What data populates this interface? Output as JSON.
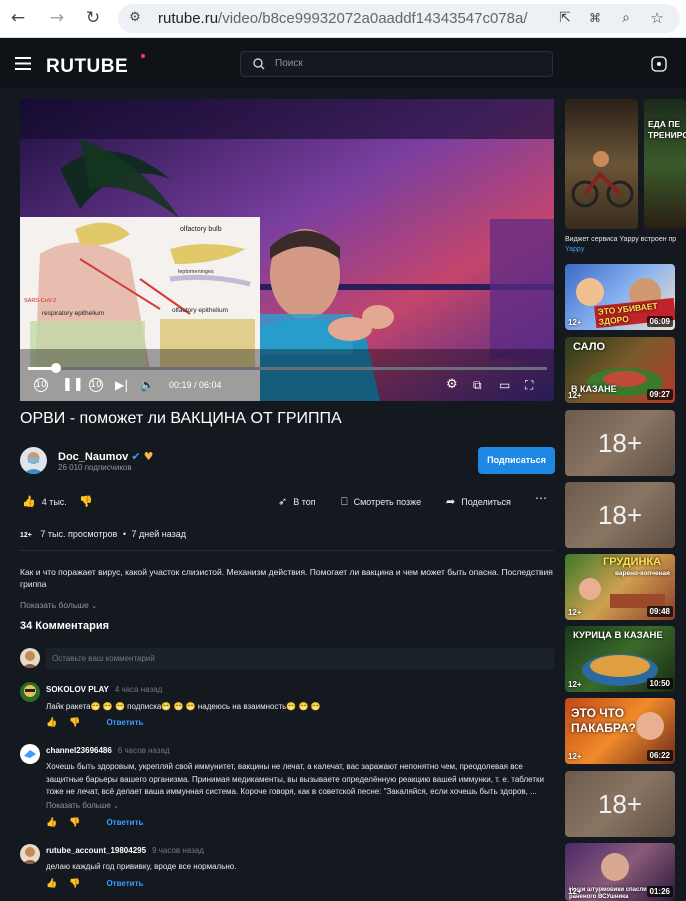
{
  "browser": {
    "back_icon": "back-arrow-icon",
    "url_domain": "rutube.ru",
    "url_path": "/video/b8ce99932072a0aaddf14343547c078a/"
  },
  "header": {
    "logo": "RUTUBE",
    "search_placeholder": "Поиск"
  },
  "player": {
    "time": "00:19 / 06:04",
    "overlay_label_1": "olfactory bulb",
    "overlay_label_2": "leptomeninges",
    "overlay_label_3": "respiratory epithelium",
    "overlay_label_4": "olfactory epithelium",
    "overlay_label_5": "SARS-CoV-2",
    "progress_fraction": 0.053,
    "rewind_label": "10",
    "forward_label": "10"
  },
  "video": {
    "title": "ОРВИ - поможет ли ВАКЦИНА ОТ ГРИППА",
    "channel": "Doc_Naumov",
    "subscribers": "26 010 подписчиков",
    "subscribe_label": "Подписаться",
    "likes": "4 тыс.",
    "to_top": "В топ",
    "watch_later": "Смотреть позже",
    "share": "Поделиться",
    "age_badge": "12+",
    "views": "7 тыс. просмотров",
    "dot": "•",
    "posted": "7 дней назад",
    "description": "Как и что поражает вирус, какой участок слизистой. Механизм действия. Помогает ли вакцина и чем может быть опасна. Последствия гриппа",
    "show_more": "Показать больше"
  },
  "comments": {
    "count_label": "34 Комментария",
    "input_placeholder": "Оставьте ваш комментарий",
    "reply_label": "Ответить",
    "items": [
      {
        "author": "SOKOLOV PLAY",
        "ago": "4 часа назад",
        "text": "Лайк ракета😁 😁 😁 подписка😁 😁 😁 надеюсь на взаимность😁 😁 😁"
      },
      {
        "author": "channel23696486",
        "ago": "6 часов назад",
        "text": "Хочешь быть здоровым, укрепляй свой иммунитет,  вакцины не лечат, а калечат, вас заражают непонятно чем, преодолевая все защитные барьеры вашего организма. Принимая медикаменты, вы вызываете определённую реакцию вашей иммунки, т. е. таблетки тоже не лечат, всё делает ваша иммунная система.   Короче говоря, как в советской песне: \"Закаляйся, если хочешь быть здоров, ...",
        "show_more": "Показать больше"
      },
      {
        "author": "rutube_account_19804295",
        "ago": "9 часов назад",
        "text": "делаю каждый год прививку, вроде все нормально."
      }
    ]
  },
  "sidebar": {
    "ad_caption": "Виджет сервиса Yappy встроен пр",
    "ad_source": "Yappy",
    "ad_overlay": "ЕДА ПЕ ТРЕНИРО",
    "cards": [
      {
        "overlay": "ЭТО УБИВАЕТ ЗДОРО",
        "age": "12+",
        "duration": "06:09"
      },
      {
        "overlay": "САЛО",
        "overlay2": "В КАЗАНЕ",
        "age": "12+",
        "duration": "09:27"
      },
      {
        "overlay": "18+",
        "age": "",
        "duration": ""
      },
      {
        "overlay": "18+",
        "age": "",
        "duration": ""
      },
      {
        "overlay": "ГРУДИНКА",
        "overlay2": "варено-копченая",
        "age": "12+",
        "duration": "09:48"
      },
      {
        "overlay": "КУРИЦА В КАЗАНЕ",
        "age": "12+",
        "duration": "10:50"
      },
      {
        "overlay": "ЭТО ЧТО ПАКАБРА?",
        "age": "12+",
        "duration": "06:22"
      },
      {
        "overlay": "18+",
        "age": "",
        "duration": ""
      },
      {
        "overlay": "Наши штурмовики спасли раненого ВСУшника",
        "age": "12+",
        "duration": "01:26"
      }
    ]
  },
  "colors": {
    "page_bg": "#14191f",
    "header_bg": "#0f1317",
    "accent": "#1e88e5",
    "reply": "#3b9cff"
  }
}
